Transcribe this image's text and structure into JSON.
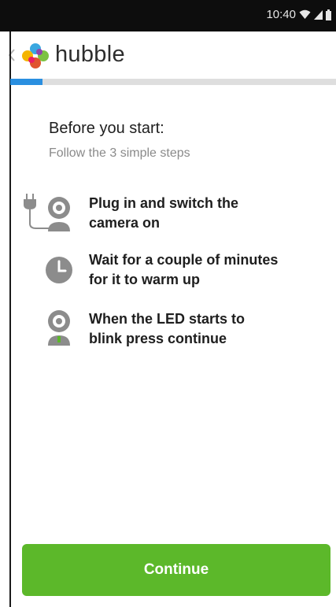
{
  "status_bar": {
    "time": "10:40",
    "icons": [
      "wifi-icon",
      "signal-icon",
      "battery-icon"
    ]
  },
  "app_bar": {
    "back_icon": "chevron-left-icon",
    "logo_icon": "hubble-logo-icon",
    "brand": "hubble"
  },
  "progress": {
    "value": 0.1,
    "fill_color": "#2a8fe0",
    "track_color": "#dedede"
  },
  "intro": {
    "title": "Before you start:",
    "subtitle": "Follow the 3 simple steps"
  },
  "steps": [
    {
      "icon": "plug-camera-icon",
      "line1": "Plug in and switch the",
      "line2": "camera on"
    },
    {
      "icon": "clock-icon",
      "line1": "Wait for a couple of minutes",
      "line2": "for it to warm up"
    },
    {
      "icon": "camera-led-icon",
      "line1": "When the LED starts to",
      "line2": "blink press continue"
    }
  ],
  "continue_button": {
    "label": "Continue",
    "color": "#5cb82a"
  },
  "colors": {
    "status_bar": "#0d0d0d",
    "icon_gray": "#8c8c8c",
    "led_green": "#5cb82a"
  }
}
